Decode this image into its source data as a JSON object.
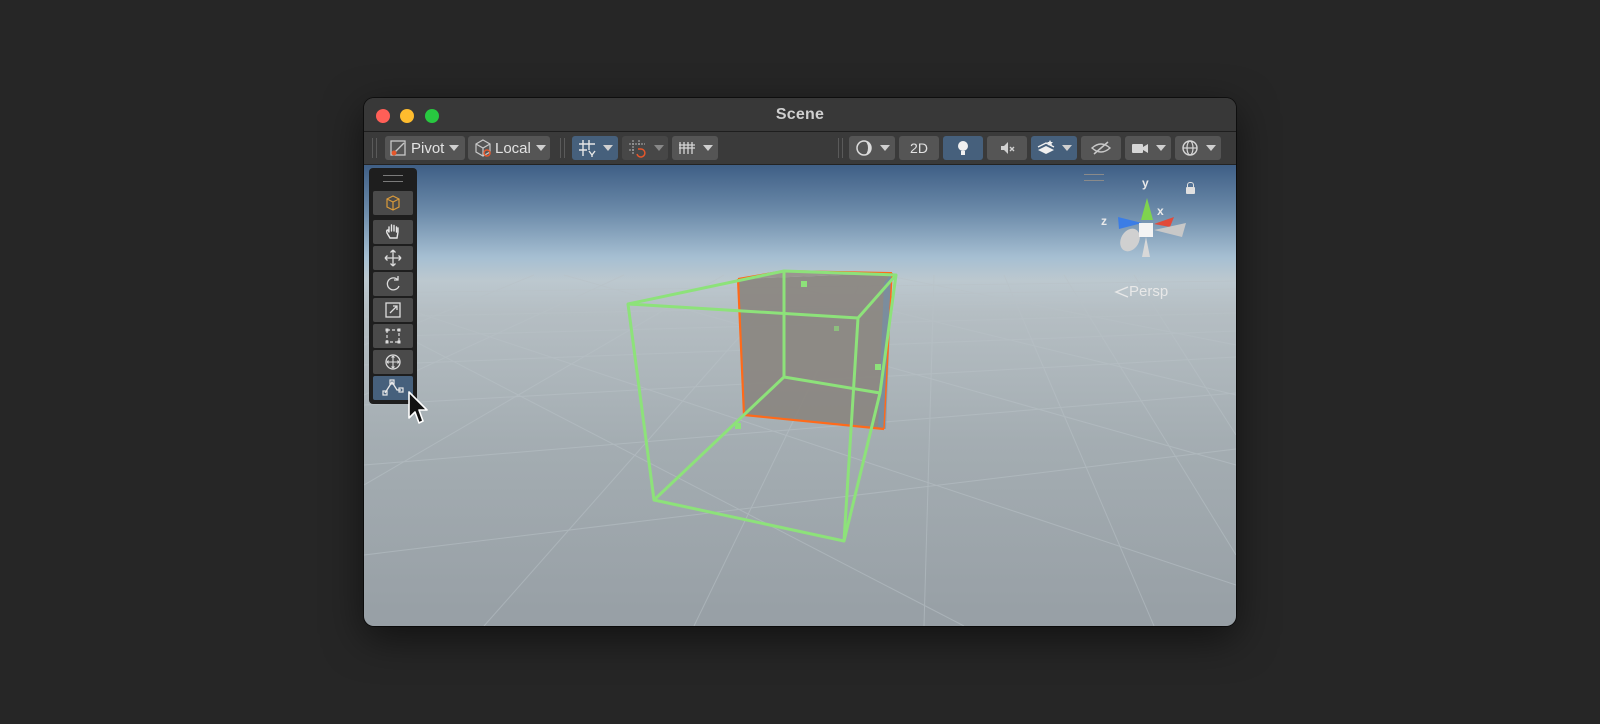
{
  "window": {
    "title": "Scene"
  },
  "toolbar": {
    "pivot_label": "Pivot",
    "local_label": "Local",
    "twod_label": "2D",
    "icons": [
      "pivot-icon",
      "local-icon",
      "grid-snap-icon",
      "increment-snap-icon",
      "grid-visibility-icon",
      "shading-mode-icon",
      "lighting-icon",
      "audio-icon",
      "effects-icon",
      "visibility-icon",
      "camera-icon",
      "gizmos-icon"
    ]
  },
  "tools": [
    "view-tool",
    "move-tool",
    "rotate-tool",
    "scale-tool",
    "rect-tool",
    "transform-tool",
    "custom-tool"
  ],
  "gizmo": {
    "x_label": "x",
    "y_label": "y",
    "z_label": "z",
    "projection_label": "Persp"
  },
  "colors": {
    "selection_outline": "#ff6a1a",
    "bounds_wire": "#8de27a",
    "active_button": "#46607c"
  }
}
